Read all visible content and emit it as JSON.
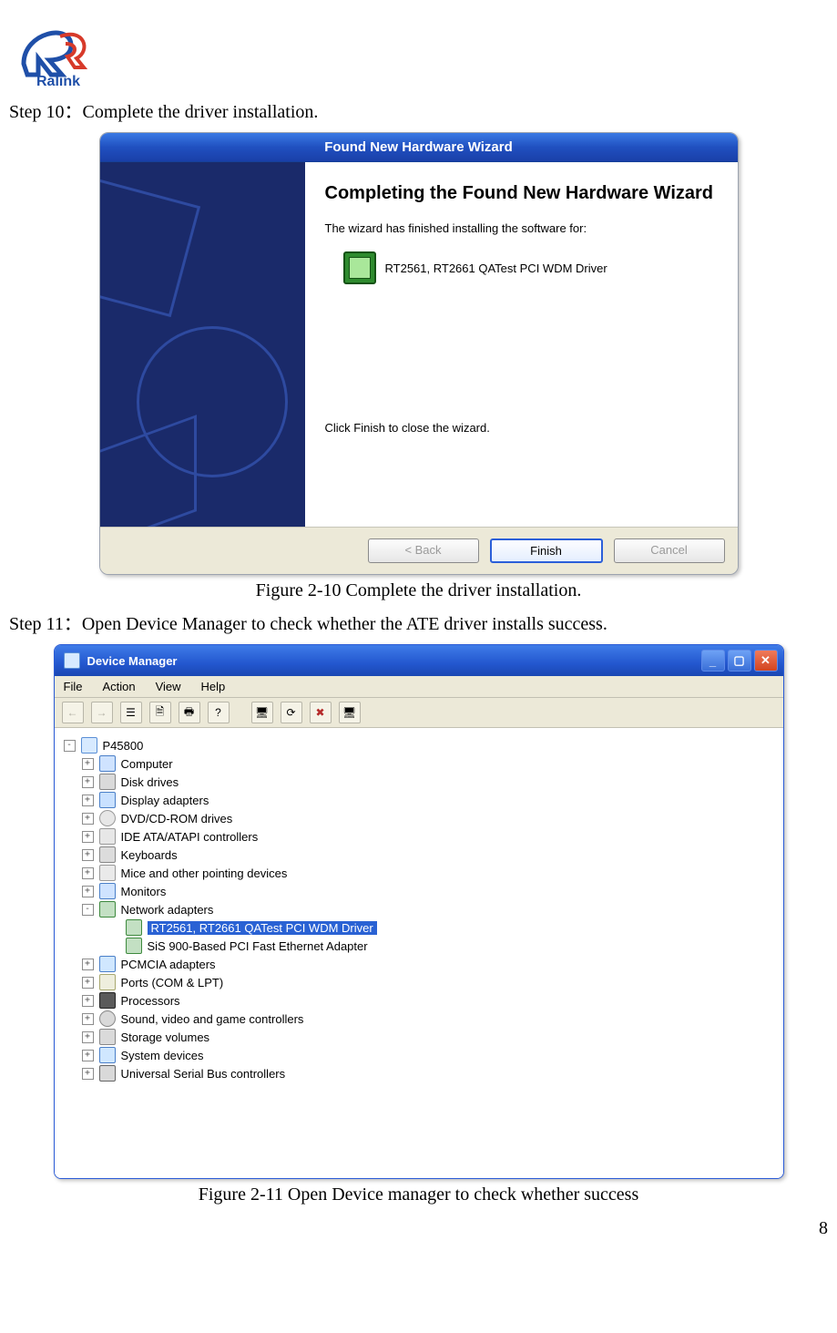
{
  "logo": {
    "brand": "Ralink"
  },
  "step10": "Step 10：Complete the driver installation.",
  "figure10": {
    "window_title": "Found New Hardware Wizard",
    "heading": "Completing the Found New Hardware Wizard",
    "desc": "The wizard has finished installing the software for:",
    "driver_name": "RT2561, RT2661 QATest PCI WDM Driver",
    "click_finish": "Click Finish to close the wizard.",
    "buttons": {
      "back": "< Back",
      "finish": "Finish",
      "cancel": "Cancel"
    },
    "caption": "Figure 2-10 Complete the driver installation."
  },
  "step11": "Step 11：Open Device Manager to check whether the ATE driver installs success.",
  "figure11": {
    "window_title": "Device Manager",
    "menu": {
      "file": "File",
      "action": "Action",
      "view": "View",
      "help": "Help"
    },
    "root": "P45800",
    "nodes": {
      "computer": "Computer",
      "disk": "Disk drives",
      "display": "Display adapters",
      "dvd": "DVD/CD-ROM drives",
      "ide": "IDE ATA/ATAPI controllers",
      "keyboards": "Keyboards",
      "mice": "Mice and other pointing devices",
      "monitors": "Monitors",
      "network": "Network adapters",
      "net_item_selected": "RT2561, RT2661 QATest PCI WDM Driver",
      "net_item2": "SiS 900-Based PCI Fast Ethernet Adapter",
      "pcmcia": "PCMCIA adapters",
      "ports": "Ports (COM & LPT)",
      "processors": "Processors",
      "sound": "Sound, video and game controllers",
      "storage": "Storage volumes",
      "system": "System devices",
      "usb": "Universal Serial Bus controllers"
    },
    "caption": "Figure 2-11 Open Device manager to check whether success"
  },
  "page_number": "8"
}
